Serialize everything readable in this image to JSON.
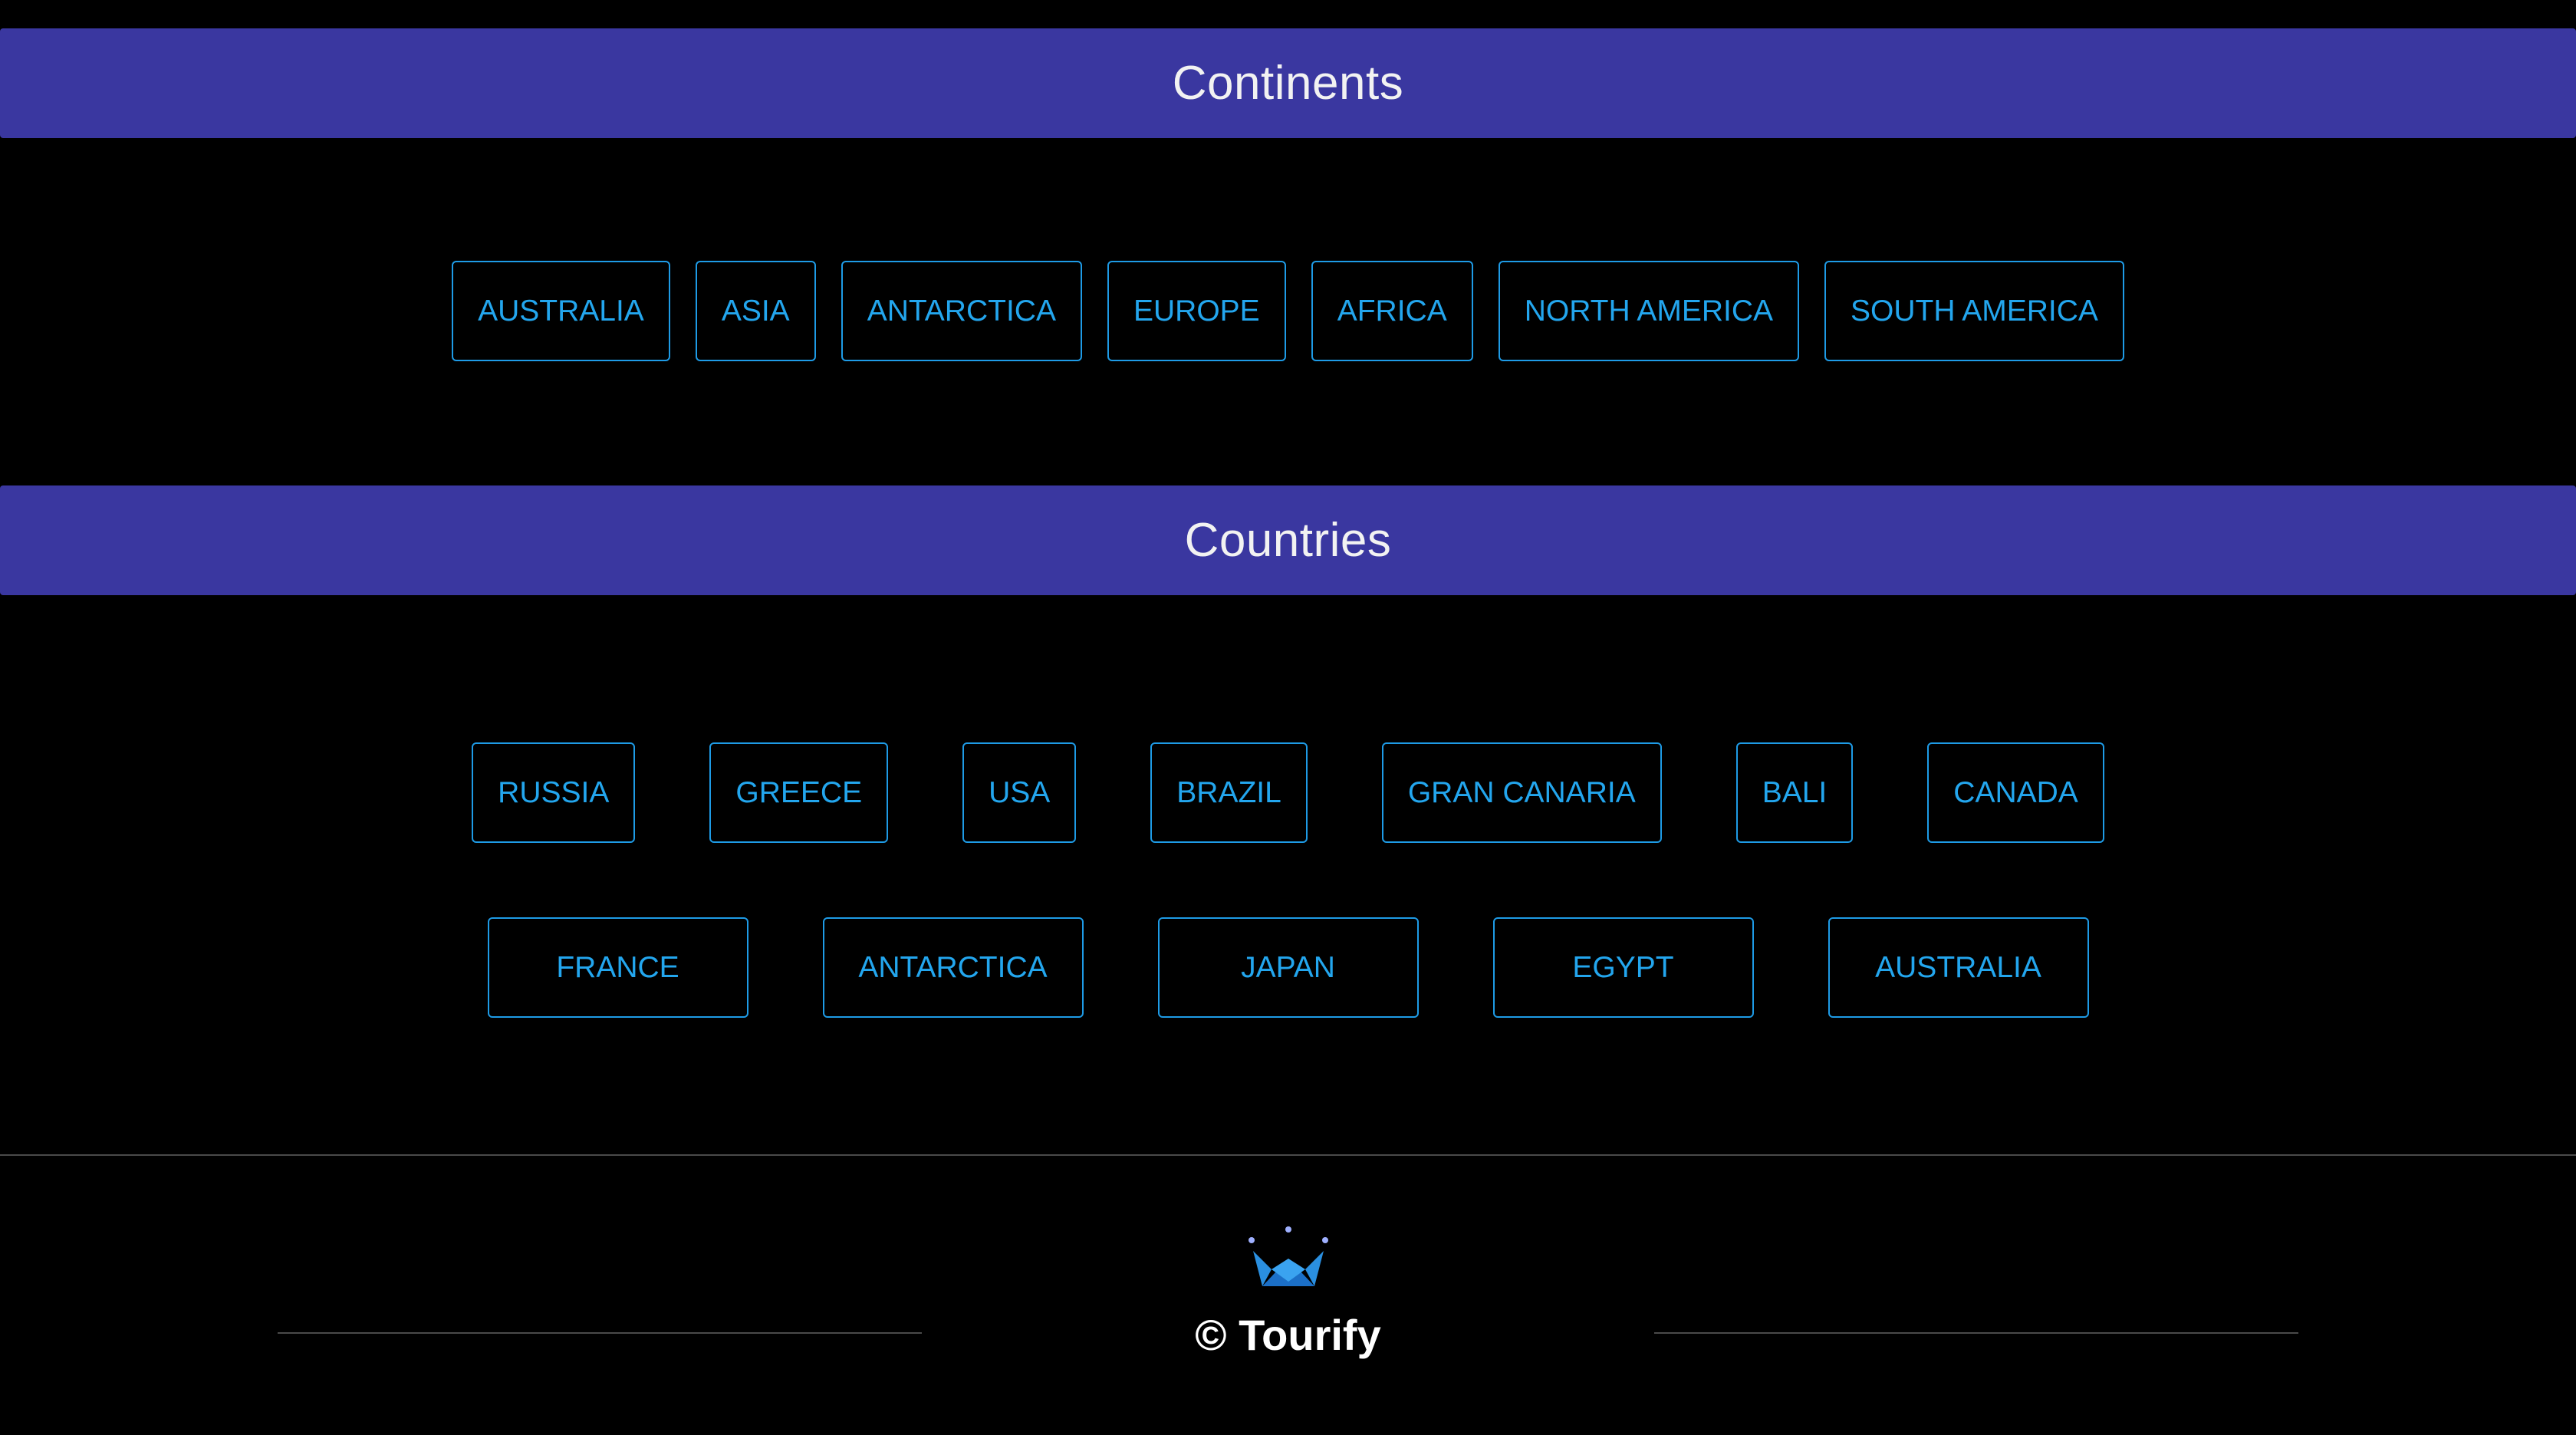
{
  "continents": {
    "title": "Continents",
    "items": [
      "AUSTRALIA",
      "ASIA",
      "ANTARCTICA",
      "EUROPE",
      "AFRICA",
      "NORTH AMERICA",
      "SOUTH AMERICA"
    ]
  },
  "countries": {
    "title": "Countries",
    "row1": [
      "RUSSIA",
      "GREECE",
      "USA",
      "BRAZIL",
      "GRAN CANARIA",
      "BALI",
      "CANADA"
    ],
    "row2": [
      "FRANCE",
      "ANTARCTICA",
      "JAPAN",
      "EGYPT",
      "AUSTRALIA"
    ]
  },
  "footer": {
    "copyright": "© Tourify",
    "logo_icon": "crown-icon"
  },
  "colors": {
    "header_bg": "#3a37a0",
    "button_border": "#1e9be6",
    "button_text": "#23a6ee",
    "background": "#000000"
  }
}
